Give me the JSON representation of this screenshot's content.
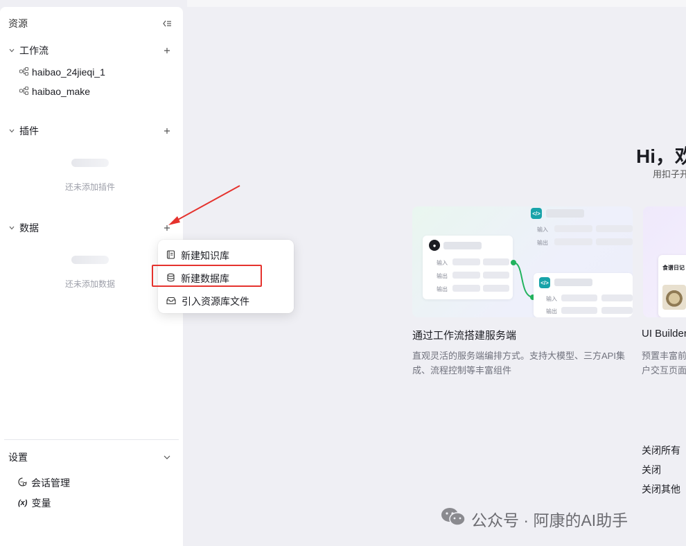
{
  "sidebar": {
    "title": "资源",
    "workflow": {
      "title": "工作流",
      "items": [
        "haibao_24jieqi_1",
        "haibao_make"
      ]
    },
    "plugin": {
      "title": "插件",
      "empty_text": "还未添加插件"
    },
    "data": {
      "title": "数据",
      "empty_text": "还未添加数据"
    },
    "settings": {
      "title": "设置",
      "items": [
        {
          "icon": "chat-settings-icon",
          "label": "会话管理"
        },
        {
          "icon": "variable-icon",
          "glyph": "(x)",
          "label": "变量"
        }
      ]
    }
  },
  "dropdown": {
    "items": [
      {
        "icon": "knowledge-base-icon",
        "label": "新建知识库"
      },
      {
        "icon": "database-icon",
        "label": "新建数据库"
      },
      {
        "icon": "import-file-icon",
        "label": "引入资源库文件"
      }
    ]
  },
  "main": {
    "greeting": "Hi，欢",
    "greeting_sub": "用扣子开",
    "card1": {
      "title": "通过工作流搭建服务端",
      "desc": "直观灵活的服务端编排方式。支持大模型、三方API集成、流程控制等丰富组件",
      "preview": {
        "in": "输入",
        "out": "输出",
        "end": "输出"
      }
    },
    "card2": {
      "title": "UI Builder",
      "desc_line1": "预置丰富前",
      "desc_line2": "户交互页面",
      "preview_title": "食谱日记"
    },
    "context_menu": [
      "关闭所有",
      "关闭",
      "关闭其他"
    ]
  },
  "watermark": "公众号 · 阿康的AI助手",
  "colors": {
    "highlight": "#e5322d",
    "accent_green": "#22b35e",
    "accent_teal": "#18a3a9"
  }
}
